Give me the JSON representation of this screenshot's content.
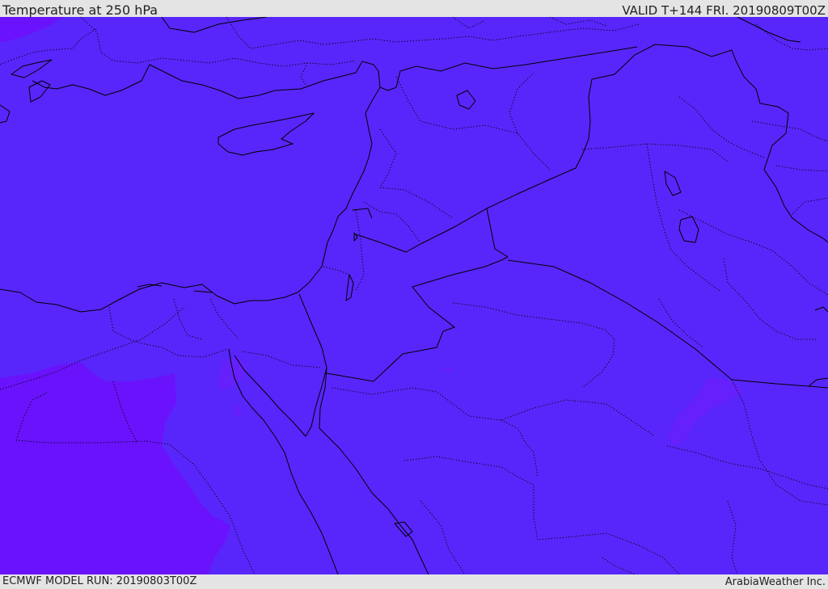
{
  "header": {
    "title": "Temperature at 250 hPa",
    "valid_time": "VALID T+144 FRI. 20190809T00Z"
  },
  "footer": {
    "model_run": "ECMWF MODEL RUN: 20190803T00Z",
    "credit": "ArabiaWeather Inc."
  },
  "colors": {
    "field_base": "#5826fa",
    "field_cold": "#6a12fb",
    "field_cool_patch": "#6520fb",
    "bar_background": "#e4e4e4",
    "coastline": "#000000"
  }
}
